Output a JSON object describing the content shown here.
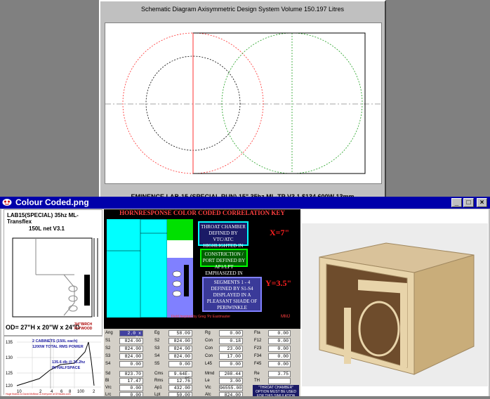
{
  "schematic": {
    "title": "Schematic Diagram   Axisymmetric Design   System Volume 150.197 Litres",
    "footer": "EMINENCE LAB-15 (SPECIAL RUN) 15\" 35hz ML-TP V3.1 $134 600W 13mm"
  },
  "window": {
    "title": "Colour Coded.png",
    "min_label": "_",
    "max_label": "□",
    "close_label": "×"
  },
  "left": {
    "heading": "LAB15(SPECIAL) 35hz ML-Transflex",
    "subheading": "150L net V3.1",
    "dims": "OD= 27\"H x 20\"W x 24\"D",
    "material": "3/4\"BIRCH PLYWOOD",
    "graph_label1": "2 CABINETS (150L each)",
    "graph_label2": "1200W TOTAL RMS POWER",
    "graph_label3": "135.6 db @ 35.2hz",
    "graph_label4": "IN HALFSPACE",
    "graph_credit": "Huge thanks to David McBean & everyone at DIYaudio.com",
    "y_ticks": [
      "135",
      "130",
      "125",
      "120"
    ],
    "x_ticks": [
      "10",
      "2",
      "4",
      "6",
      "8",
      "100",
      "2"
    ]
  },
  "middle": {
    "header": "HORNRESPONSE COLOR CODED CORRELATION KEY",
    "x_label": "X=7\"",
    "y_label": "Y=3.5\"",
    "box1": "THROAT CHAMBER DEFINED BY VTC/ATC HIGHLIGHTED IN AQUA",
    "box2": "CONSTRICTION / PORT DEFINED BY AP1/LPT EMPHASIZED IN GREEN",
    "box3": "SEGMENTS 1 - 4 DEFINED BY S1-S4 DISPLAYED IN A PLEASANT SHADE OF PERIWINKLE",
    "inspired": "Field Inspired by Greg 'Pz Eastmaster",
    "mmj": "MMJ",
    "note": "\"THROAT CHAMBER\" OPTION MUST BE USED FOR THIS SIMULATION",
    "fields": [
      {
        "l": "Ang",
        "v": "2.0 x Pi"
      },
      {
        "l": "Eg",
        "v": "58.09"
      },
      {
        "l": "Rg",
        "v": "0.00"
      },
      {
        "l": "Fta",
        "v": "0.00"
      },
      {
        "l": "S1",
        "v": "824.00"
      },
      {
        "l": "S2",
        "v": "824.00"
      },
      {
        "l": "Con",
        "v": "0.18"
      },
      {
        "l": "F12",
        "v": "0.00"
      },
      {
        "l": "S2",
        "v": "824.00"
      },
      {
        "l": "S3",
        "v": "824.00"
      },
      {
        "l": "Con",
        "v": "23.00"
      },
      {
        "l": "F23",
        "v": "0.00"
      },
      {
        "l": "S3",
        "v": "824.00"
      },
      {
        "l": "S4",
        "v": "824.00"
      },
      {
        "l": "Con",
        "v": "17.00"
      },
      {
        "l": "F34",
        "v": "0.00"
      },
      {
        "l": "S4",
        "v": "0.00"
      },
      {
        "l": "S5",
        "v": "0.00"
      },
      {
        "l": "L45",
        "v": "0.00"
      },
      {
        "l": "F45",
        "v": "0.00"
      }
    ],
    "driver_fields": [
      {
        "l": "Sd",
        "v": "823.70"
      },
      {
        "l": "Cms",
        "v": "9.64E-05"
      },
      {
        "l": "Mmd",
        "v": "208.44"
      },
      {
        "l": "Re",
        "v": "3.75"
      },
      {
        "l": "Bl",
        "v": "17.47"
      },
      {
        "l": "Rms",
        "v": "12.76"
      },
      {
        "l": "Le",
        "v": "3.00"
      },
      {
        "l": "TH",
        "v": ""
      },
      {
        "l": "Vrc",
        "v": "0.00"
      },
      {
        "l": "Ap1",
        "v": "432.00"
      },
      {
        "l": "Vtc",
        "v": "96555.00"
      },
      {
        "l": "Lrc",
        "v": "0.00"
      },
      {
        "l": "Lpt",
        "v": "50.00"
      },
      {
        "l": "Atc",
        "v": "824.00"
      }
    ]
  },
  "colors": {
    "aqua": "#00ffff",
    "green": "#00c000",
    "periwinkle": "#8080ff",
    "red": "#ff0000",
    "titlebar": "#0000aa"
  }
}
